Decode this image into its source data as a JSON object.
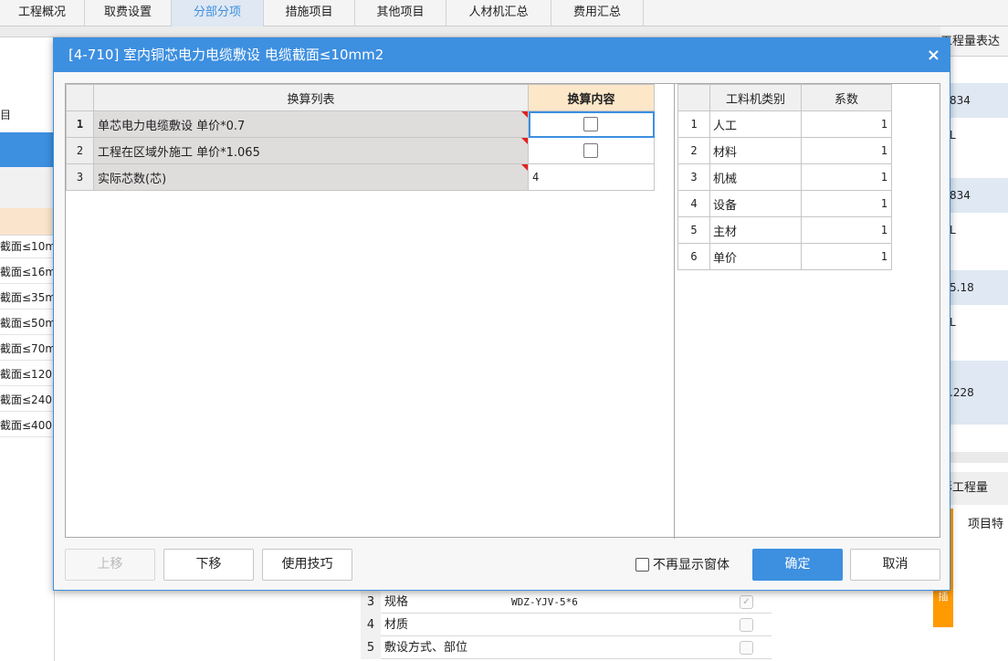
{
  "tabs": [
    {
      "label": "工程概况",
      "active": false
    },
    {
      "label": "取费设置",
      "active": false
    },
    {
      "label": "分部分项",
      "active": true
    },
    {
      "label": "措施项目",
      "active": false
    },
    {
      "label": "其他项目",
      "active": false
    },
    {
      "label": "人材机汇总",
      "active": false
    },
    {
      "label": "费用汇总",
      "active": false
    }
  ],
  "background": {
    "left_label": "目",
    "left_rows": [
      "截面≤10m",
      "截面≤16m",
      "截面≤35m",
      "截面≤50m",
      "截面≤70m",
      "截面≤120",
      "截面≤240",
      "截面≤400"
    ],
    "right_header": "工程量表达",
    "right_cells": [
      "834",
      "L",
      "834",
      "L",
      "5.18",
      "L",
      ".228"
    ],
    "right_header2": "形工程量",
    "right_header3": "项目特",
    "right_orange_text": "插",
    "bottom_rows": [
      {
        "num": "3",
        "name": "规格",
        "value": "WDZ-YJV-5*6",
        "checked": true
      },
      {
        "num": "4",
        "name": "材质",
        "value": "",
        "checked": false
      },
      {
        "num": "5",
        "name": "敷设方式、部位",
        "value": "",
        "checked": false
      }
    ]
  },
  "dialog": {
    "title": "[4-710] 室内铜芯电力电缆敷设 电缆截面≤10mm2",
    "close_icon": "×",
    "left_table": {
      "headers": [
        "换算列表",
        "换算内容"
      ],
      "rows": [
        {
          "num": "1",
          "name": "单芯电力电缆敷设 单价*0.7",
          "type": "checkbox",
          "value": ""
        },
        {
          "num": "2",
          "name": "工程在区域外施工 单价*1.065",
          "type": "checkbox",
          "value": ""
        },
        {
          "num": "3",
          "name": "实际芯数(芯)",
          "type": "text",
          "value": "4"
        }
      ]
    },
    "right_table": {
      "headers": [
        "工料机类别",
        "系数"
      ],
      "rows": [
        {
          "num": "1",
          "category": "人工",
          "coef": "1"
        },
        {
          "num": "2",
          "category": "材料",
          "coef": "1"
        },
        {
          "num": "3",
          "category": "机械",
          "coef": "1"
        },
        {
          "num": "4",
          "category": "设备",
          "coef": "1"
        },
        {
          "num": "5",
          "category": "主材",
          "coef": "1"
        },
        {
          "num": "6",
          "category": "单价",
          "coef": "1"
        }
      ]
    },
    "buttons": {
      "move_up": "上移",
      "move_down": "下移",
      "tips": "使用技巧",
      "no_show_again": "不再显示窗体",
      "ok": "确定",
      "cancel": "取消"
    }
  },
  "colors": {
    "accent": "#3d8fe0",
    "header_highlight": "#fde7c9",
    "marker": "#e02020",
    "orange": "#ff9a00"
  }
}
